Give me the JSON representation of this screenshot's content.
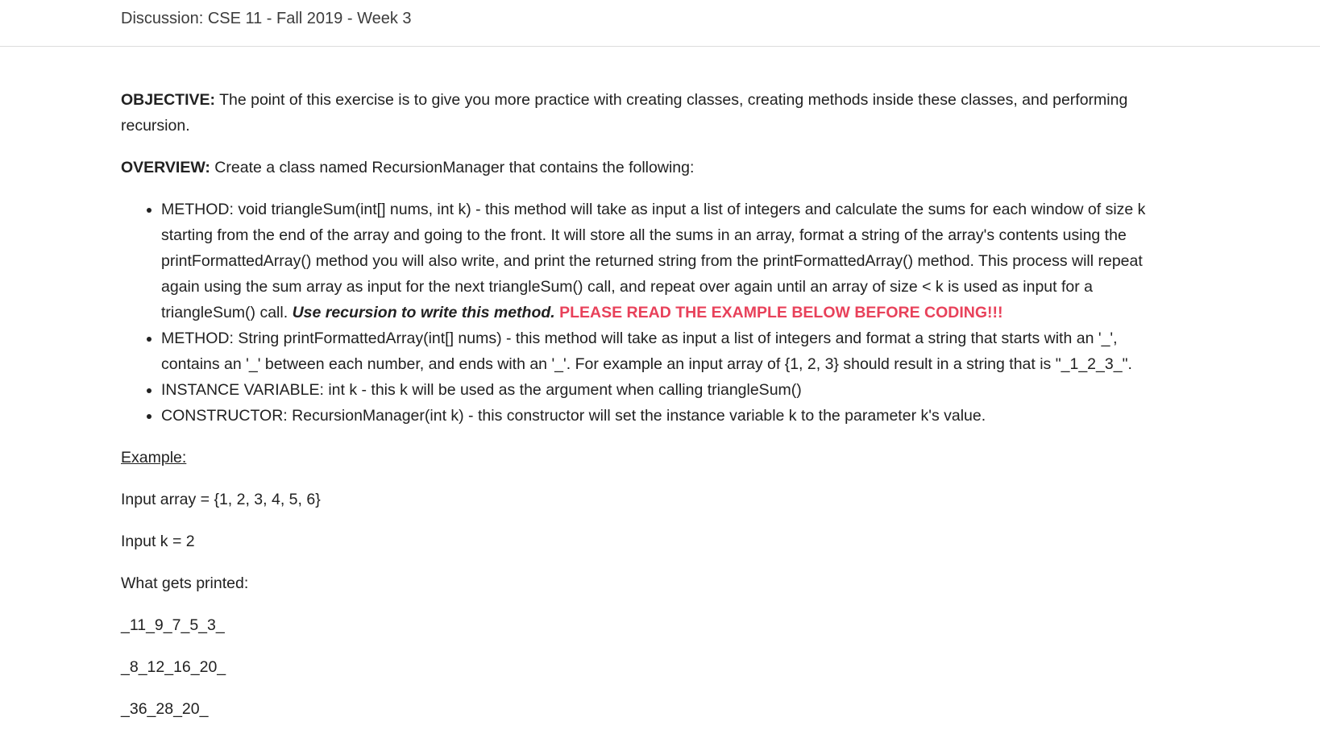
{
  "header": {
    "title": "Discussion: CSE 11 - Fall 2019 - Week 3"
  },
  "objective": {
    "label": "OBJECTIVE:",
    "text": " The point of this exercise is to give you more practice with creating classes, creating methods inside these classes, and performing recursion."
  },
  "overview": {
    "label": "OVERVIEW:",
    "text": " Create a class named RecursionManager that contains the following:"
  },
  "bullets": {
    "triangle_sum": {
      "text": " METHOD: void triangleSum(int[] nums, int k) - this method will take as input a list of integers and calculate the sums for each window of size k starting from the end of the array and going to the front. It will store all the sums in an array, format a string of the array's contents using the printFormattedArray() method you will also write, and print the returned string from the printFormattedArray() method. This process will repeat again using the sum array as input for the next triangleSum() call, and repeat over again until an array of size < k is used as input for a triangleSum() call. ",
      "emphasis": "Use recursion to write this method.",
      "warning": " PLEASE READ THE EXAMPLE BELOW BEFORE CODING!!!"
    },
    "print_formatted": {
      "text": "METHOD: String printFormattedArray(int[] nums) - this method will take as input a list of integers and format a string that starts with an '_', contains an '_' between each number, and ends with an '_'. For example an input array of {1, 2, 3} should result in a string that is \"_1_2_3_\"."
    },
    "instance_var": {
      "text": "INSTANCE VARIABLE: int k - this k will be used as the argument when calling triangleSum()"
    },
    "constructor": {
      "text": "CONSTRUCTOR: RecursionManager(int k) - this constructor will set the instance variable k to the parameter k's value."
    }
  },
  "example": {
    "heading": "Example:",
    "input_array": "Input array = {1, 2, 3, 4, 5, 6}",
    "input_k": "Input k = 2",
    "printed_label": "What gets printed:",
    "outputs": [
      "_11_9_7_5_3_",
      "_8_12_16_20_",
      "_36_28_20_"
    ]
  }
}
